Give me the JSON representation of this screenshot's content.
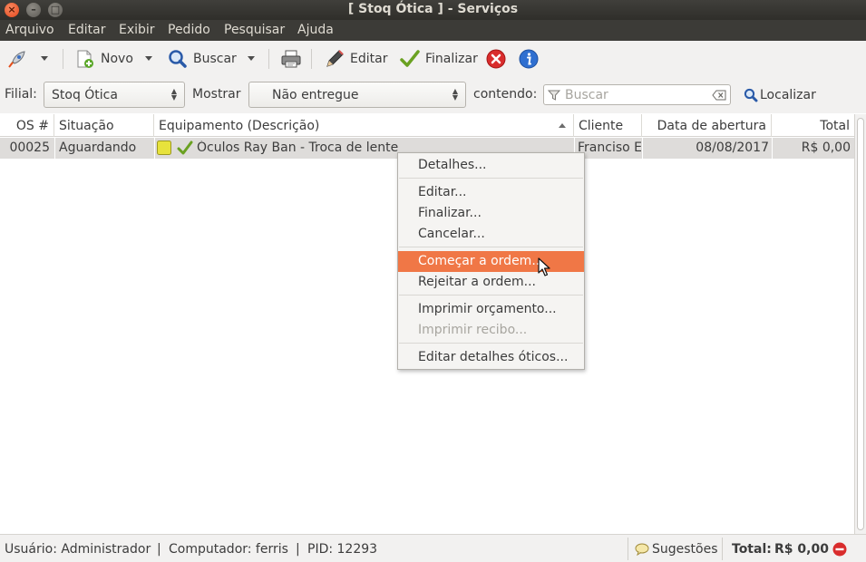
{
  "window": {
    "title": "[ Stoq Ótica ] - Serviços"
  },
  "menubar": {
    "items": [
      "Arquivo",
      "Editar",
      "Exibir",
      "Pedido",
      "Pesquisar",
      "Ajuda"
    ]
  },
  "toolbar": {
    "novo_label": "Novo",
    "buscar_label": "Buscar",
    "editar_label": "Editar",
    "finalizar_label": "Finalizar"
  },
  "filters": {
    "filial_label": "Filial:",
    "filial_value": "Stoq Ótica",
    "mostrar_label": "Mostrar",
    "mostrar_value": "Não entregue",
    "contendo_label": "contendo:",
    "search_placeholder": "Buscar",
    "localizar_label": "Localizar"
  },
  "table": {
    "columns": [
      "OS #",
      "Situação",
      "Equipamento (Descrição)",
      "Cliente",
      "Data de abertura",
      "Total"
    ],
    "rows": [
      {
        "os": "00025",
        "situacao": "Aguardando",
        "equipamento": "Óculos Ray Ban  - Troca de lente",
        "cliente": "Franciso Elisio de Lima Junior",
        "data": "08/08/2017",
        "total": "R$ 0,00"
      }
    ]
  },
  "context_menu": {
    "items": [
      {
        "label": "Detalhes..."
      },
      {
        "label": "Editar..."
      },
      {
        "label": "Finalizar..."
      },
      {
        "label": "Cancelar..."
      },
      {
        "label": "Começar a ordem..."
      },
      {
        "label": "Rejeitar a ordem..."
      },
      {
        "label": "Imprimir orçamento..."
      },
      {
        "label": "Imprimir recibo..."
      },
      {
        "label": "Editar detalhes óticos..."
      }
    ]
  },
  "statusbar": {
    "usuario": "Usuário: Administrador",
    "computador": "Computador: ferris",
    "pid": "PID: 12293",
    "sugestoes": "Sugestões",
    "total_label": "Total:",
    "total_value": "R$ 0,00"
  },
  "colors": {
    "menu_highlight": "#f07746",
    "titlebar": "#3c3b37",
    "close_red": "#e4461c",
    "info_blue": "#2f6fd0"
  }
}
